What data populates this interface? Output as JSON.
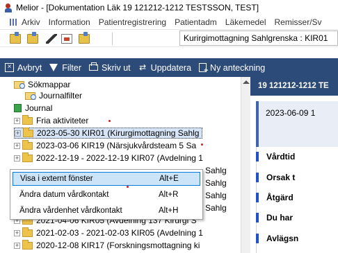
{
  "window": {
    "title": "Melior - [Dokumentation Läk 19 121212-1212 TESTSSON, TEST]"
  },
  "menubar": {
    "items": [
      "Arkiv",
      "Information",
      "Patientregistrering",
      "Patientadm",
      "Läkemedel",
      "Remisser/Sv"
    ]
  },
  "toolbar1": {
    "unit": "Kurirgimottagning Sahlgrenska : KIR01"
  },
  "toolbar2": {
    "items": [
      "Avbryt",
      "Filter",
      "Skriv ut",
      "Uppdatera",
      "Ny anteckning"
    ]
  },
  "tree": {
    "rows": [
      {
        "text": "Sökmappar",
        "indent": 0,
        "icon": "search-folder-icon"
      },
      {
        "text": "Journalfilter",
        "indent": 1,
        "icon": "search-folder-icon"
      },
      {
        "text": "Journal",
        "indent": 0,
        "icon": "journal-icon"
      },
      {
        "text": "Fria aktiviteter",
        "indent": 1,
        "icon": "folder-icon"
      },
      {
        "text": "2023-05-30   KIR01 (Kirurgimottagning Sahlg",
        "indent": 1,
        "icon": "folder-icon",
        "selected": true
      },
      {
        "text": "2023-03-06   KIR19 (Närsjukvårdsteam 5 Sa",
        "indent": 1,
        "icon": "folder-icon"
      },
      {
        "text": "2022-12-19 - 2022-12-19 KIR07 (Avdelning 1",
        "indent": 1,
        "icon": "folder-icon"
      },
      {
        "text": "Sahlg",
        "indent": 1,
        "icon": "none"
      },
      {
        "text": "Sahlg",
        "indent": 1,
        "icon": "none"
      },
      {
        "text": "Sahlg",
        "indent": 1,
        "icon": "none"
      },
      {
        "text": "Sahlg",
        "indent": 1,
        "icon": "none"
      },
      {
        "text": "2021-04-06   KIR05 (Avdelning 137 Kirurgi S",
        "indent": 1,
        "icon": "folder-icon"
      },
      {
        "text": "2021-02-03 - 2021-02-03 KIR05 (Avdelning 1",
        "indent": 1,
        "icon": "folder-icon"
      },
      {
        "text": "2020-12-08   KIR17 (Forskningsmottagning ki",
        "indent": 1,
        "icon": "folder-icon"
      }
    ]
  },
  "context_menu": {
    "items": [
      {
        "label": "Visa i externt fönster",
        "shortcut": "Alt+E",
        "active": true
      },
      {
        "label": "Ändra datum vårdkontakt",
        "shortcut": "Alt+R",
        "active": false
      },
      {
        "label": "Ändra vårdenhet vårdkontakt",
        "shortcut": "Alt+H",
        "active": false
      }
    ]
  },
  "right_panel": {
    "header": "19 121212-1212 TE",
    "date": "2023-06-09 1",
    "labels": [
      "Vårdtid",
      "Orsak t",
      "Åtgärd",
      "Du har",
      "Avlägsn"
    ]
  }
}
